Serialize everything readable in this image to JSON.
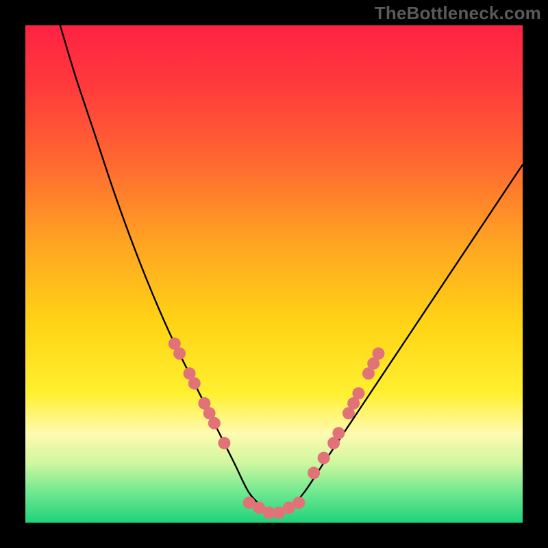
{
  "watermark": "TheBottleneck.com",
  "chart_data": {
    "type": "line",
    "title": "",
    "xlabel": "",
    "ylabel": "",
    "xlim": [
      0,
      100
    ],
    "ylim": [
      0,
      100
    ],
    "grid": false,
    "background_gradient": {
      "stops": [
        {
          "offset": 0.0,
          "color": "#ff2244"
        },
        {
          "offset": 0.12,
          "color": "#ff3a3c"
        },
        {
          "offset": 0.28,
          "color": "#ff6a30"
        },
        {
          "offset": 0.44,
          "color": "#ffa522"
        },
        {
          "offset": 0.6,
          "color": "#ffd415"
        },
        {
          "offset": 0.74,
          "color": "#fff030"
        },
        {
          "offset": 0.82,
          "color": "#fffab0"
        },
        {
          "offset": 0.88,
          "color": "#cff7a0"
        },
        {
          "offset": 0.94,
          "color": "#6ee890"
        },
        {
          "offset": 1.0,
          "color": "#1fd27a"
        }
      ]
    },
    "series": [
      {
        "name": "bottleneck-curve",
        "comment": "V-shaped curve; y approx 100 at x≈7 and x≈100, minimum y≈2 at x≈45-53",
        "x": [
          7,
          10,
          14,
          18,
          22,
          26,
          30,
          34,
          38,
          42,
          45,
          48,
          50,
          53,
          56,
          60,
          64,
          68,
          72,
          76,
          80,
          84,
          88,
          92,
          96,
          100
        ],
        "y": [
          100,
          90,
          78,
          66,
          55,
          45,
          36,
          28,
          20,
          12,
          6,
          3,
          2,
          3,
          6,
          12,
          18,
          24,
          30,
          36,
          42,
          48,
          54,
          60,
          66,
          72
        ]
      }
    ],
    "marker_series": [
      {
        "name": "left-cluster-markers",
        "color": "#e07278",
        "points": [
          {
            "x": 30,
            "y": 36
          },
          {
            "x": 31,
            "y": 34
          },
          {
            "x": 33,
            "y": 30
          },
          {
            "x": 34,
            "y": 28
          },
          {
            "x": 36,
            "y": 24
          },
          {
            "x": 37,
            "y": 22
          },
          {
            "x": 38,
            "y": 20
          },
          {
            "x": 40,
            "y": 16
          }
        ]
      },
      {
        "name": "trough-markers",
        "color": "#e07278",
        "points": [
          {
            "x": 45,
            "y": 4
          },
          {
            "x": 47,
            "y": 3
          },
          {
            "x": 49,
            "y": 2
          },
          {
            "x": 51,
            "y": 2
          },
          {
            "x": 53,
            "y": 3
          },
          {
            "x": 55,
            "y": 4
          }
        ]
      },
      {
        "name": "right-cluster-markers",
        "color": "#e07278",
        "points": [
          {
            "x": 58,
            "y": 10
          },
          {
            "x": 60,
            "y": 13
          },
          {
            "x": 62,
            "y": 16
          },
          {
            "x": 63,
            "y": 18
          },
          {
            "x": 65,
            "y": 22
          },
          {
            "x": 66,
            "y": 24
          },
          {
            "x": 67,
            "y": 26
          },
          {
            "x": 69,
            "y": 30
          },
          {
            "x": 70,
            "y": 32
          },
          {
            "x": 71,
            "y": 34
          }
        ]
      }
    ]
  }
}
